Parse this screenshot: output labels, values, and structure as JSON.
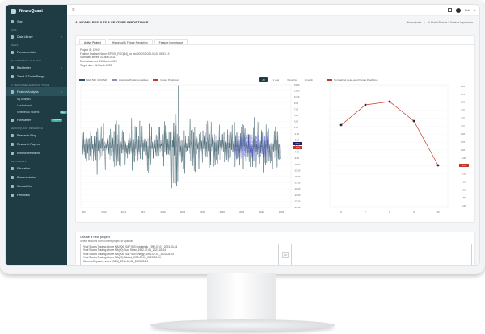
{
  "app": {
    "brand": "NeuroQuant"
  },
  "sidebar": {
    "items": [
      {
        "label": "Start",
        "icon": "home-icon"
      },
      {
        "section": "DATA"
      },
      {
        "label": "Data Library",
        "icon": "database-icon",
        "chevron": true
      },
      {
        "section": "IDEAS"
      },
      {
        "label": "Fundamentals",
        "icon": "chart-icon"
      },
      {
        "section": "QUANTITATIVE ANALYSIS"
      },
      {
        "label": "Backtester",
        "icon": "flask-icon",
        "chevron": true
      },
      {
        "label": "Trend & Trade Range",
        "icon": "trend-icon"
      },
      {
        "section": "AI / MACHINE LEARNING TOOLS"
      },
      {
        "label": "Feature Analysis",
        "icon": "brain-icon",
        "chevron": true,
        "active": true
      },
      {
        "sub": "My Analysis"
      },
      {
        "sub": "Leaderboard"
      },
      {
        "sub": "Selected AI models",
        "badge": "New"
      },
      {
        "label": "Forecaster",
        "icon": "forecast-icon",
        "badge": "Upgrade"
      },
      {
        "section": "NEUROQUANT RESEARCH"
      },
      {
        "label": "Research Blog",
        "icon": "blog-icon"
      },
      {
        "label": "Research Papers",
        "icon": "paper-icon"
      },
      {
        "label": "Kimetic Research",
        "icon": "research-icon"
      },
      {
        "section": "RESOURCES"
      },
      {
        "label": "Education",
        "icon": "education-icon"
      },
      {
        "label": "Documentation",
        "icon": "docs-icon"
      },
      {
        "label": "Contact Us",
        "icon": "mail-icon"
      },
      {
        "label": "Feedback",
        "icon": "feedback-icon"
      }
    ]
  },
  "topbar": {
    "user": "Erik"
  },
  "page": {
    "title": "AI-MODEL RESULTS & FEATURE IMPORTANCE",
    "breadcrumb": [
      "NeuroQuant",
      ">",
      "AI-Model Results & Feature Importance"
    ]
  },
  "tabs": [
    {
      "label": "Active Project",
      "active": true
    },
    {
      "label": "Historical & Future Prediction",
      "active": false
    },
    {
      "label": "Feature Importance",
      "active": false
    }
  ],
  "project": {
    "lines": [
      "Project ID: 15942",
      "Feature Analysis Name: SPX50_ROC[5d]_no mix 20020-2023-03-08 08:51:13",
      "Start data series: 02-May-2011",
      "End data series: 03-March-2023",
      "Target date: 31-March-2023"
    ]
  },
  "left_chart": {
    "legend": [
      "S&P 500_ROC[5d]",
      "Historical Prediction Values",
      "Future Prediction"
    ],
    "zoom": [
      {
        "label": "All",
        "on": true
      },
      {
        "label": "1 year",
        "on": false
      },
      {
        "label": "6 months",
        "on": false
      },
      {
        "label": "1 month",
        "on": false
      }
    ],
    "y_ticks": [
      "15.00",
      "13.00",
      "11.00",
      "9.00",
      "7.00",
      "5.00",
      "3.00",
      "1.00",
      "-1.00",
      "-3.00",
      "-5.00",
      "-7.00",
      "-9.00",
      "-11.00",
      "-13.00",
      "-15.00",
      "-17.00",
      "-19.00",
      "-21.00",
      "-23.00",
      "-25.00"
    ],
    "x_ticks": [
      "2011",
      "2012",
      "2014",
      "2015",
      "2016",
      "2018",
      "2019",
      "2020",
      "2021",
      "2022",
      "2023"
    ],
    "last_badges": [
      "0.34",
      "-1.31"
    ],
    "colors": {
      "actual": "#2f5560",
      "historical": "#8c92a8",
      "future": "#3b3bd6"
    }
  },
  "chart_data": {
    "type": "line",
    "title": "Normalized close-up of Future Prediction",
    "x": [
      6,
      7,
      8,
      9,
      10
    ],
    "series": [
      {
        "values": [
          1.8,
          3.05,
          3.25,
          2.05,
          -0.7
        ]
      }
    ],
    "y_ticks": [
      "4.20",
      "3.70",
      "3.20",
      "2.70",
      "2.20",
      "1.70",
      "1.20",
      "0.70",
      "0.20",
      "-0.30",
      "-0.80",
      "-1.30",
      "-1.80",
      "-2.30",
      "-2.80",
      "-3.30"
    ],
    "ylim": [
      -3.3,
      4.3
    ],
    "last_badge": "-0.70",
    "line_color": "#c0392b",
    "point_color": "#2b2b2b"
  },
  "create_project": {
    "title": "Create a new project",
    "subtitle": "Select features from current project to optimize",
    "features": [
      "% of Stocks Trading Above MA(200) S&P 500 Industrials_1992-07-01_2023-03-24",
      "% of Stocks Trading Above MA(20) Euro Stoxx_1992-07-01_2023-03-24",
      "% of Stocks Trading Above MA(200) S&P 500 Energy_1992-07-01_2023-03-24",
      "% of Stocks Trading Above MA(20) Global_1992-07-01_2023-03-24",
      "Gamma Exposure Index (GEX)_2011-05-02_2023-03-24"
    ],
    "move_label": ">>"
  }
}
